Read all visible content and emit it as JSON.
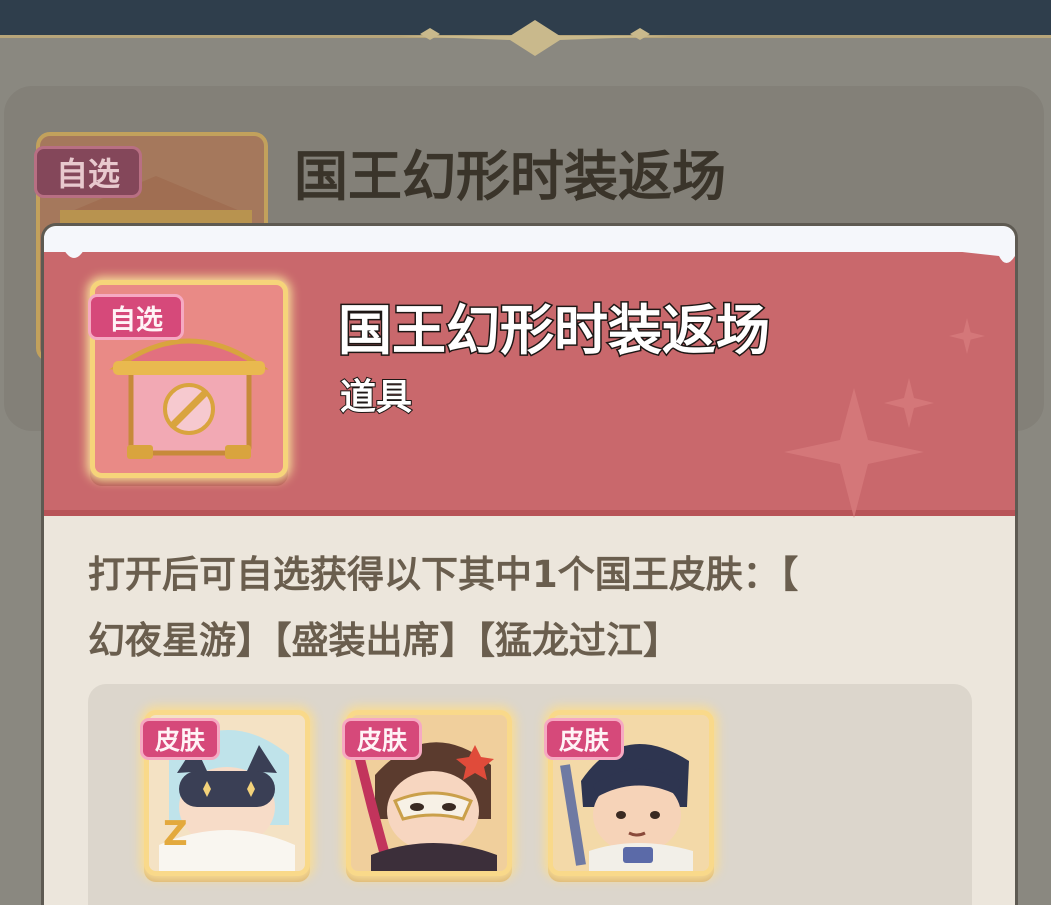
{
  "background": {
    "tag_label": "自选",
    "title": "国王幻形时装返场"
  },
  "popup": {
    "item": {
      "tag_label": "自选",
      "title": "国王幻形时装返场",
      "type": "道具",
      "icon": "treasure-chest-icon"
    },
    "description_line1": "打开后可自选获得以下其中1个国王皮肤：【",
    "description_line2": "幻夜星游】【盛装出席】【猛龙过江】",
    "skins": [
      {
        "tag_label": "皮肤",
        "icon": "masked-cat-hero-avatar-icon"
      },
      {
        "tag_label": "皮肤",
        "icon": "masquerade-hero-avatar-icon"
      },
      {
        "tag_label": "皮肤",
        "icon": "dark-hair-hero-avatar-icon"
      }
    ]
  },
  "colors": {
    "header_red": "#c9686c",
    "gold_frame": "#f6d47a",
    "tag_pink": "#d6497a",
    "body_cream": "#ece6dc",
    "desc_text": "#6a5e4e"
  }
}
